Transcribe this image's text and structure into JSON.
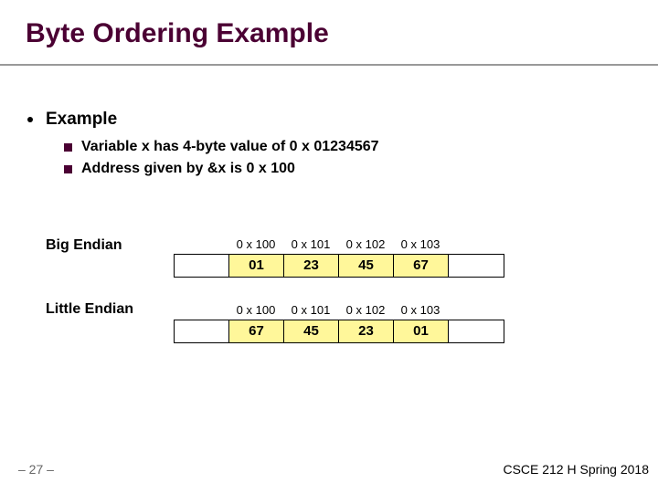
{
  "title": "Byte Ordering Example",
  "bullets": {
    "top": "Example",
    "subs": [
      "Variable x has 4-byte value of 0 x 01234567",
      "Address given by &x is 0 x 100"
    ]
  },
  "big_endian": {
    "label": "Big Endian",
    "addresses": [
      "0 x 100",
      "0 x 101",
      "0 x 102",
      "0 x 103"
    ],
    "bytes": [
      "",
      "01",
      "23",
      "45",
      "67",
      ""
    ]
  },
  "little_endian": {
    "label": "Little Endian",
    "addresses": [
      "0 x 100",
      "0 x 101",
      "0 x 102",
      "0 x 103"
    ],
    "bytes": [
      "",
      "67",
      "45",
      "23",
      "01",
      ""
    ]
  },
  "page_number": "– 27 –",
  "footer": "CSCE 212 H Spring 2018"
}
